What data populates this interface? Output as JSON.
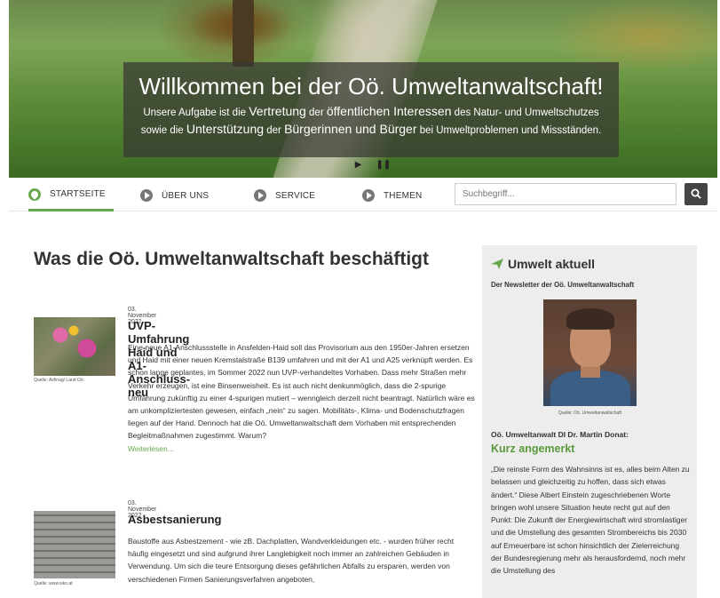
{
  "hero": {
    "title": "Willkommen bei der Oö. Umweltanwaltschaft!",
    "text_part1": "Unsere Aufgabe ist die ",
    "text_big1": "Vertretung",
    "text_part2": " der ",
    "text_big2": "öffentlichen Interessen",
    "text_part3": " des Natur- und Umweltschutzes sowie die ",
    "text_big3": "Unterstützung",
    "text_part4": " der ",
    "text_big4": "Bürgerinnen und Bürger",
    "text_part5": " bei Umweltproblemen und Missständen.",
    "play_label": "▶",
    "pause_label": "❚❚"
  },
  "nav": {
    "items": [
      {
        "label": "STARTSEITE"
      },
      {
        "label": "ÜBER UNS"
      },
      {
        "label": "SERVICE"
      },
      {
        "label": "THEMEN"
      }
    ],
    "search_placeholder": "Suchbegriff..."
  },
  "main": {
    "title": "Was die Oö. Umweltanwaltschaft beschäftigt",
    "articles": [
      {
        "date": "03. November 2022",
        "title": "UVP-Umfahrung Haid und A1-Anschluss-neu",
        "caption": "Quelle: Asfinag/ Land Oö.",
        "body": "Eine neue A1-Anschlussstelle in Ansfelden-Haid soll das Provisorium aus den 1950er-Jahren ersetzen und Haid mit einer neuen Kremstalstraße B139 umfahren und mit der A1 und A25 verknüpft werden. Es schon lange geplantes, im Sommer 2022 nun UVP-verhandeltes Vorhaben. Dass mehr Straßen mehr Verkehr erzeugen, ist eine Binsenweisheit. Es ist auch nicht denkunmöglich, dass die 2-spurige Umfahrung zukünftig zu einer 4-spurigen mutiert – wenngleich derzeit nicht beantragt. Natürlich wäre es am unkompliziertesten gewesen, einfach „nein“ zu sagen. Mobilitäts-, Klima- und Bodenschutzfragen liegen auf der Hand. Dennoch hat die Oö. Umweltanwaltschaft dem Vorhaben mit entsprechenden Begleitmaßnahmen zugestimmt. Warum?",
        "more": "Weiterlesen..."
      },
      {
        "date": "03. November 2022",
        "title": "Asbestsanierung",
        "caption": "Quelle: www.wko.at",
        "body": "Baustoffe aus Asbestzement - wie zB. Dachplatten, Wandverkleidungen etc. - wurden früher recht häufig eingesetzt und sind aufgrund ihrer Langlebigkeit noch immer an zahlreichen Gebäuden in Verwendung. Um sich die teure Entsorgung dieses gefährlichen Abfalls zu ersparen, werden von verschiedenen Firmen Sanierungsverfahren angeboten,"
      }
    ]
  },
  "sidebar": {
    "title": "Umwelt aktuell",
    "subtitle": "Der Newsletter der Oö. Umweltanwaltschaft",
    "photo_caption": "Quelle: Oö. Umweltanwaltschaft",
    "author": "Oö. Umweltanwalt DI Dr. Martin Donat:",
    "heading": "Kurz angemerkt",
    "text": "„Die reinste Form des Wahnsinns ist es, alles beim Alten zu belassen und gleichzeitig zu hoffen, dass sich etwas ändert.“ Diese Albert Einstein zugeschriebenen Worte bringen wohl unsere Situation heute recht gut auf den Punkt: Die Zukunft der Energiewirtschaft wird stromlastiger und die Umstellung des gesamten Strombereichs bis 2030 auf Erneuerbare ist schon hinsichtlich der Zielerreichung der Bundesregierung mehr als herausfordernd, noch mehr die Umstellung des"
  },
  "colors": {
    "accent": "#6aa84f",
    "sidebar_bg": "#ededed"
  }
}
